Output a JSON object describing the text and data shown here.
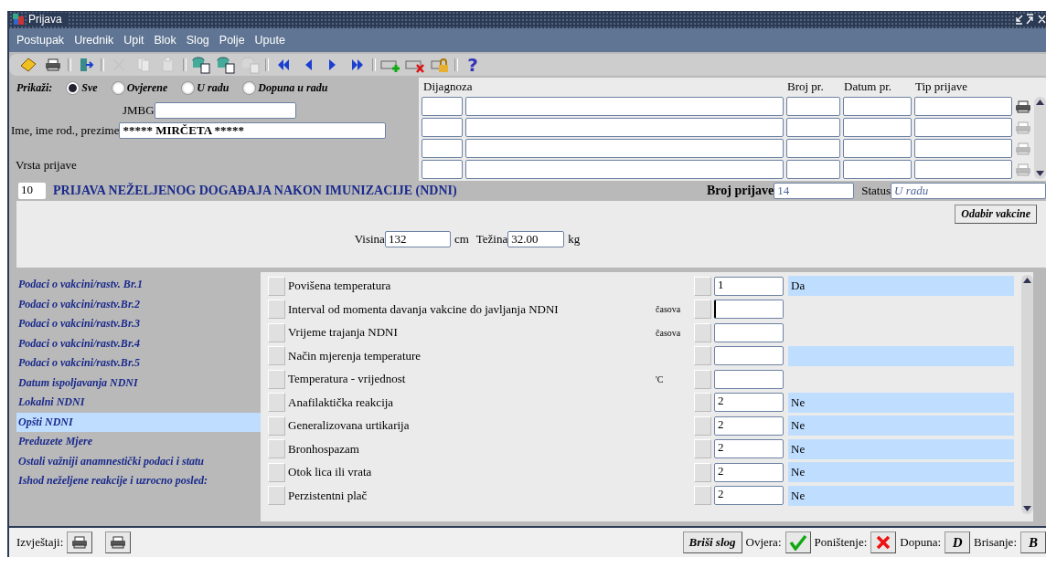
{
  "window": {
    "title": "Prijava"
  },
  "menu": [
    "Postupak",
    "Urednik",
    "Upit",
    "Blok",
    "Slog",
    "Polje",
    "Upute"
  ],
  "toolbar": [
    [
      {
        "kind": "save",
        "disabled": false
      },
      {
        "kind": "print",
        "disabled": false
      }
    ],
    [
      {
        "kind": "exit",
        "disabled": false
      }
    ],
    [
      {
        "kind": "cut",
        "disabled": true
      },
      {
        "kind": "copy",
        "disabled": true
      },
      {
        "kind": "paste",
        "disabled": true
      }
    ],
    [
      {
        "kind": "query",
        "disabled": false
      },
      {
        "kind": "execute",
        "disabled": false
      },
      {
        "kind": "cancel",
        "disabled": true
      }
    ],
    [
      {
        "kind": "first",
        "disabled": false
      },
      {
        "kind": "prev",
        "disabled": false
      },
      {
        "kind": "next",
        "disabled": false
      },
      {
        "kind": "last",
        "disabled": false
      }
    ],
    [
      {
        "kind": "insert",
        "disabled": false
      },
      {
        "kind": "delete",
        "disabled": false
      },
      {
        "kind": "lock",
        "disabled": false
      }
    ],
    [
      {
        "kind": "help",
        "label": "?",
        "disabled": false
      }
    ]
  ],
  "filter": {
    "label": "Prikaži:",
    "options": [
      {
        "label": "Sve",
        "selected": true
      },
      {
        "label": "Ovjerene",
        "selected": false
      },
      {
        "label": "U radu",
        "selected": false
      },
      {
        "label": "Dopuna u radu",
        "selected": false
      }
    ]
  },
  "jmbg": {
    "label": "JMBG"
  },
  "name": {
    "label": "Ime, ime rod., prezime",
    "value": "***** MIRČETA *****"
  },
  "diagnoses": {
    "columns": [
      "Dijagnoza",
      "Broj pr.",
      "Datum pr.",
      "Tip prijave"
    ],
    "rows": [
      {
        "printable": true
      },
      {
        "printable": false
      },
      {
        "printable": false
      },
      {
        "printable": false
      }
    ]
  },
  "report_type": {
    "label": "Vrsta prijave",
    "code": "10",
    "title": "PRIJAVA NEŽELJENOG DOGAĐAJA NAKON IMUNIZACIJE (NDNI)"
  },
  "report_number": {
    "label": "Broj prijave",
    "value": "14"
  },
  "status": {
    "label": "Status",
    "value": "U radu"
  },
  "vaccine_button": "Odabir vakcine",
  "height": {
    "label": "Visina",
    "value": "132",
    "unit": "cm"
  },
  "weight": {
    "label": "Težina",
    "value": "32.00",
    "unit": "kg"
  },
  "sections": [
    {
      "label": "Podaci o vakcini/rastv. Br.1",
      "selected": false
    },
    {
      "label": "Podaci o vakcini/rastv.Br.2",
      "selected": false
    },
    {
      "label": "Podaci o vakcini/rastv.Br.3",
      "selected": false
    },
    {
      "label": "Podaci o vakcini/rastv.Br.4",
      "selected": false
    },
    {
      "label": "Podaci o vakcini/rastv.Br.5",
      "selected": false
    },
    {
      "label": "Datum ispoljavanja NDNI",
      "selected": false
    },
    {
      "label": "Lokalni NDNI",
      "selected": false
    },
    {
      "label": "Opšti NDNI",
      "selected": true
    },
    {
      "label": "Preduzete Mjere",
      "selected": false
    },
    {
      "label": "Ostali važniji anamnestički podaci i statu",
      "selected": false
    },
    {
      "label": "Ishod neželjene reakcije i uzrocno posled:",
      "selected": false
    }
  ],
  "symptoms": [
    {
      "kind": "coded",
      "label": "Povišena temperatura",
      "value": "1",
      "description": "Da",
      "focused": false
    },
    {
      "kind": "numeric",
      "label": "Interval od momenta davanja vakcine do javljanja NDNI",
      "unit": "časova",
      "focused": true
    },
    {
      "kind": "numeric",
      "label": "Vrijeme trajanja NDNI",
      "unit": "časova",
      "focused": false
    },
    {
      "kind": "coded",
      "label": "Način mjerenja temperature",
      "focused": false
    },
    {
      "kind": "numeric",
      "label": "Temperatura - vrijednost",
      "unit": "'C",
      "focused": false
    },
    {
      "kind": "coded",
      "label": "Anafilaktička reakcija",
      "value": "2",
      "description": "Ne",
      "focused": false
    },
    {
      "kind": "coded",
      "label": "Generalizovana urtikarija",
      "value": "2",
      "description": "Ne",
      "focused": false
    },
    {
      "kind": "coded",
      "label": "Bronhospazam",
      "value": "2",
      "description": "Ne",
      "focused": false
    },
    {
      "kind": "coded",
      "label": "Otok lica ili vrata",
      "value": "2",
      "description": "Ne",
      "focused": false
    },
    {
      "kind": "coded",
      "label": "Perzistentni plač",
      "value": "2",
      "description": "Ne",
      "focused": false
    }
  ],
  "footer": {
    "reports_label": "Izvještaji:",
    "delete_record": "Briši slog",
    "verify_label": "Ovjera:",
    "cancel_label": "Poništenje:",
    "supplement_label": "Dopuna:",
    "supplement_key": "D",
    "delete_label": "Brisanje:",
    "delete_key": "B"
  }
}
